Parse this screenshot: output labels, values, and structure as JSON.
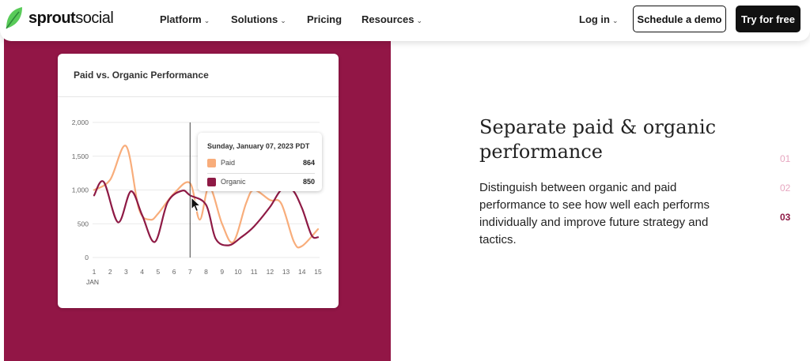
{
  "nav": {
    "brand_bold": "sprout",
    "brand_light": "social",
    "platform": "Platform",
    "solutions": "Solutions",
    "pricing": "Pricing",
    "resources": "Resources",
    "login": "Log in",
    "demo": "Schedule a demo",
    "trial": "Try for free",
    "caret": "⌄"
  },
  "colors": {
    "brand_green": "#59CB59",
    "panel": "#921646",
    "paid": "#F8AD7B",
    "organic": "#8E1A45",
    "step_inactive": "#E7A7C0",
    "step_active": "#8E1A45"
  },
  "card": {
    "title": "Paid vs. Organic Performance",
    "tooltip": {
      "date": "Sunday, January 07, 2023 PDT",
      "rows": [
        {
          "label": "Paid",
          "value": "864"
        },
        {
          "label": "Organic",
          "value": "850"
        }
      ]
    }
  },
  "chart_data": {
    "type": "line",
    "x": [
      1,
      2,
      3,
      4,
      5,
      6,
      7,
      8,
      9,
      10,
      11,
      12,
      13,
      14,
      15
    ],
    "x_tick_labels": [
      "1",
      "2",
      "3",
      "4",
      "5",
      "6",
      "7",
      "8",
      "9",
      "10",
      "11",
      "12",
      "13",
      "14",
      "15"
    ],
    "x_sublabel": "JAN",
    "y_tick_labels": [
      "0",
      "500",
      "1,000",
      "1,500",
      "2,000"
    ],
    "ylim": [
      0,
      2000
    ],
    "series": [
      {
        "name": "Paid",
        "color": "#F8AD7B",
        "points": [
          [
            1,
            1000
          ],
          [
            2,
            1150
          ],
          [
            3,
            1650
          ],
          [
            3.8,
            720
          ],
          [
            4.5,
            560
          ],
          [
            5,
            650
          ],
          [
            6,
            950
          ],
          [
            7,
            1100
          ],
          [
            7.6,
            560
          ],
          [
            8.2,
            1050
          ],
          [
            9,
            500
          ],
          [
            9.7,
            230
          ],
          [
            10.5,
            800
          ],
          [
            11,
            1000
          ],
          [
            12,
            850
          ],
          [
            12.7,
            800
          ],
          [
            13.5,
            230
          ],
          [
            14,
            170
          ],
          [
            15,
            420
          ]
        ]
      },
      {
        "name": "Organic",
        "color": "#8E1A45",
        "points": [
          [
            1,
            920
          ],
          [
            1.6,
            1120
          ],
          [
            2.5,
            520
          ],
          [
            3.3,
            980
          ],
          [
            4,
            630
          ],
          [
            4.8,
            230
          ],
          [
            5.6,
            820
          ],
          [
            6.5,
            990
          ],
          [
            7,
            920
          ],
          [
            8,
            780
          ],
          [
            8.6,
            280
          ],
          [
            9.4,
            180
          ],
          [
            10.2,
            300
          ],
          [
            11,
            460
          ],
          [
            12,
            750
          ],
          [
            12.7,
            1000
          ],
          [
            13.4,
            1000
          ],
          [
            14,
            730
          ],
          [
            14.6,
            330
          ],
          [
            15,
            300
          ]
        ]
      }
    ],
    "highlight_x": 7,
    "grid": true,
    "legend": "tooltip"
  },
  "content": {
    "heading": "Separate paid & organic performance",
    "description": "Distinguish between organic and paid performance to see how well each performs individually and improve future strategy and tactics.",
    "steps": [
      {
        "label": "01",
        "active": false
      },
      {
        "label": "02",
        "active": false
      },
      {
        "label": "03",
        "active": true
      }
    ]
  }
}
